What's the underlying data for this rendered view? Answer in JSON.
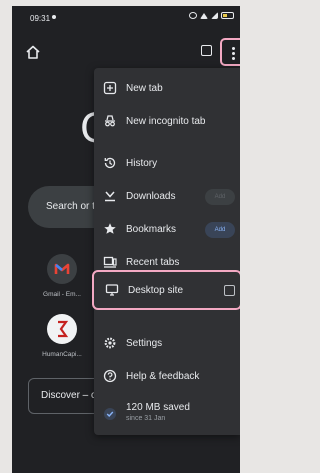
{
  "status_bar": {
    "time": "09:31"
  },
  "toolbar": {
    "home_icon": "home-icon",
    "tabs_icon": "tab-switcher-icon",
    "menu_icon": "three-dot-menu-icon"
  },
  "ntp": {
    "logo_letter": "G",
    "search_placeholder": "Search or typ",
    "shortcuts": [
      {
        "label": "Gmail - Em...",
        "color": "#ea4335"
      },
      {
        "label": "HumanCapi...",
        "color": "#c5221f"
      }
    ],
    "discover_label": "Discover – off"
  },
  "menu": {
    "items": [
      {
        "label": "New tab",
        "icon": "new-tab-icon"
      },
      {
        "label": "New incognito tab",
        "icon": "incognito-icon"
      },
      {
        "label": "History",
        "icon": "history-icon"
      },
      {
        "label": "Downloads",
        "icon": "download-icon",
        "badge": "Add"
      },
      {
        "label": "Bookmarks",
        "icon": "star-icon",
        "badge": "Add"
      },
      {
        "label": "Recent tabs",
        "icon": "recent-tabs-icon"
      },
      {
        "label": "Desktop site",
        "icon": "monitor-icon",
        "checked": false
      },
      {
        "label": "Settings",
        "icon": "gear-icon"
      },
      {
        "label": "Help & feedback",
        "icon": "help-icon"
      },
      {
        "label": "120 MB saved",
        "sublabel": "since 31 Jan",
        "icon": "data-saver-icon"
      }
    ]
  },
  "colors": {
    "background": "#202124",
    "menu_background": "#303134",
    "highlight": "#f3a9c3",
    "accent": "#8ab4f8"
  }
}
